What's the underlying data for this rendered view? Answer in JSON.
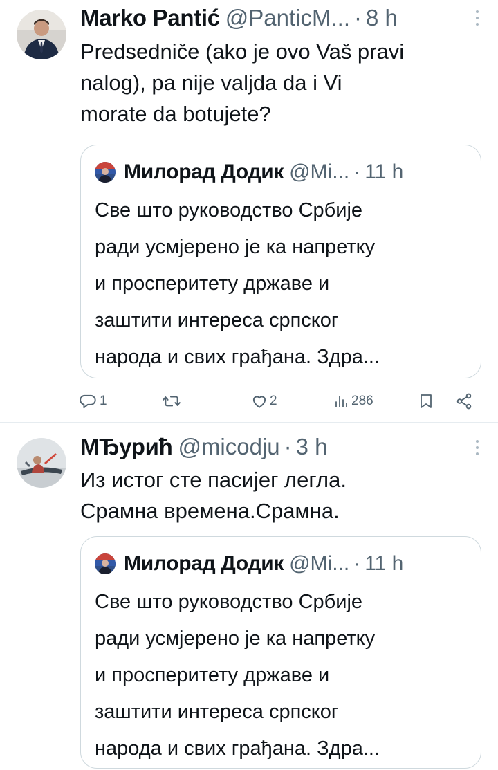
{
  "tweets": [
    {
      "author": "Marko Pantić",
      "handle": "@PanticM...",
      "dot": "·",
      "time": "8 h",
      "lines": [
        "Predsedniče (ako je ovo Vaš pravi",
        "nalog), pa nije valjda da i Vi",
        "morate da botujete?"
      ],
      "quote": {
        "author": "Милорад Додик",
        "handle": "@Mi...",
        "dot": "·",
        "time": "11 h",
        "lines": [
          "Све што руководство Србије",
          "ради усмјерено је ка напретку",
          "и просперитету државе и",
          "заштити интереса српског",
          "народа и свих грађана. Здра..."
        ]
      },
      "actions": {
        "replies": "1",
        "retweets": "",
        "likes": "2",
        "views": "286"
      }
    },
    {
      "author": "МЂурић",
      "handle": "@micodju",
      "dot": "·",
      "time": "3 h",
      "lines": [
        "Из истог сте пасијег легла.",
        "Срамна времена.Срамна."
      ],
      "quote": {
        "author": "Милорад Додик",
        "handle": "@Mi...",
        "dot": "·",
        "time": "11 h",
        "lines": [
          "Све што руководство Србије",
          "ради усмјерено је ка напретку",
          "и просперитету државе и",
          "заштити интереса српског",
          "народа и свих грађана. Здра..."
        ]
      }
    }
  ],
  "icons": {
    "reply": "reply-icon",
    "retweet": "retweet-icon",
    "like": "heart-icon",
    "views": "views-icon",
    "bookmark": "bookmark-icon",
    "share": "share-icon",
    "more": "more-dots-icon"
  },
  "colors": {
    "text": "#0f1419",
    "secondary": "#536471",
    "border": "#cfd9de"
  }
}
